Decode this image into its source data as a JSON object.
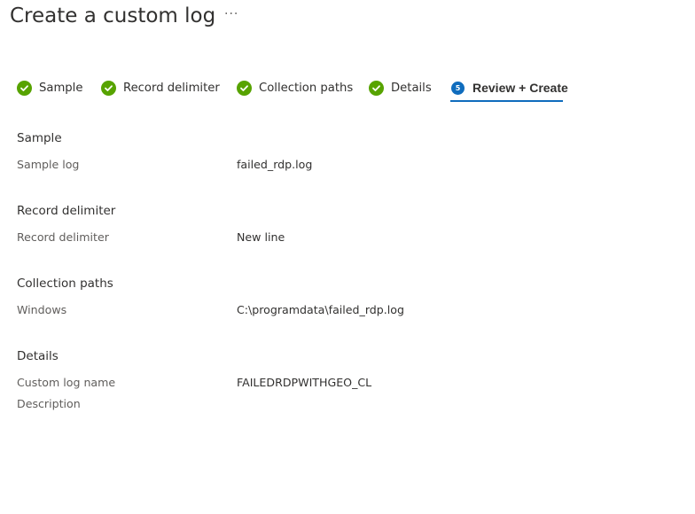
{
  "page": {
    "title": "Create a custom log",
    "more_label": "···"
  },
  "colors": {
    "complete": "#57a300",
    "active": "#0f6cbd"
  },
  "steps": [
    {
      "label": "Sample",
      "state": "complete"
    },
    {
      "label": "Record delimiter",
      "state": "complete"
    },
    {
      "label": "Collection paths",
      "state": "complete"
    },
    {
      "label": "Details",
      "state": "complete"
    },
    {
      "label": "Review + Create",
      "state": "active",
      "number": "5"
    }
  ],
  "review": {
    "sample": {
      "heading": "Sample",
      "label": "Sample log",
      "value": "failed_rdp.log"
    },
    "delimiter": {
      "heading": "Record delimiter",
      "label": "Record delimiter",
      "value": "New line"
    },
    "paths": {
      "heading": "Collection paths",
      "label": "Windows",
      "value": "C:\\programdata\\failed_rdp.log"
    },
    "details": {
      "heading": "Details",
      "name_label": "Custom log name",
      "name_value": "FAILEDRDPWITHGEO_CL",
      "description_label": "Description",
      "description_value": ""
    }
  }
}
